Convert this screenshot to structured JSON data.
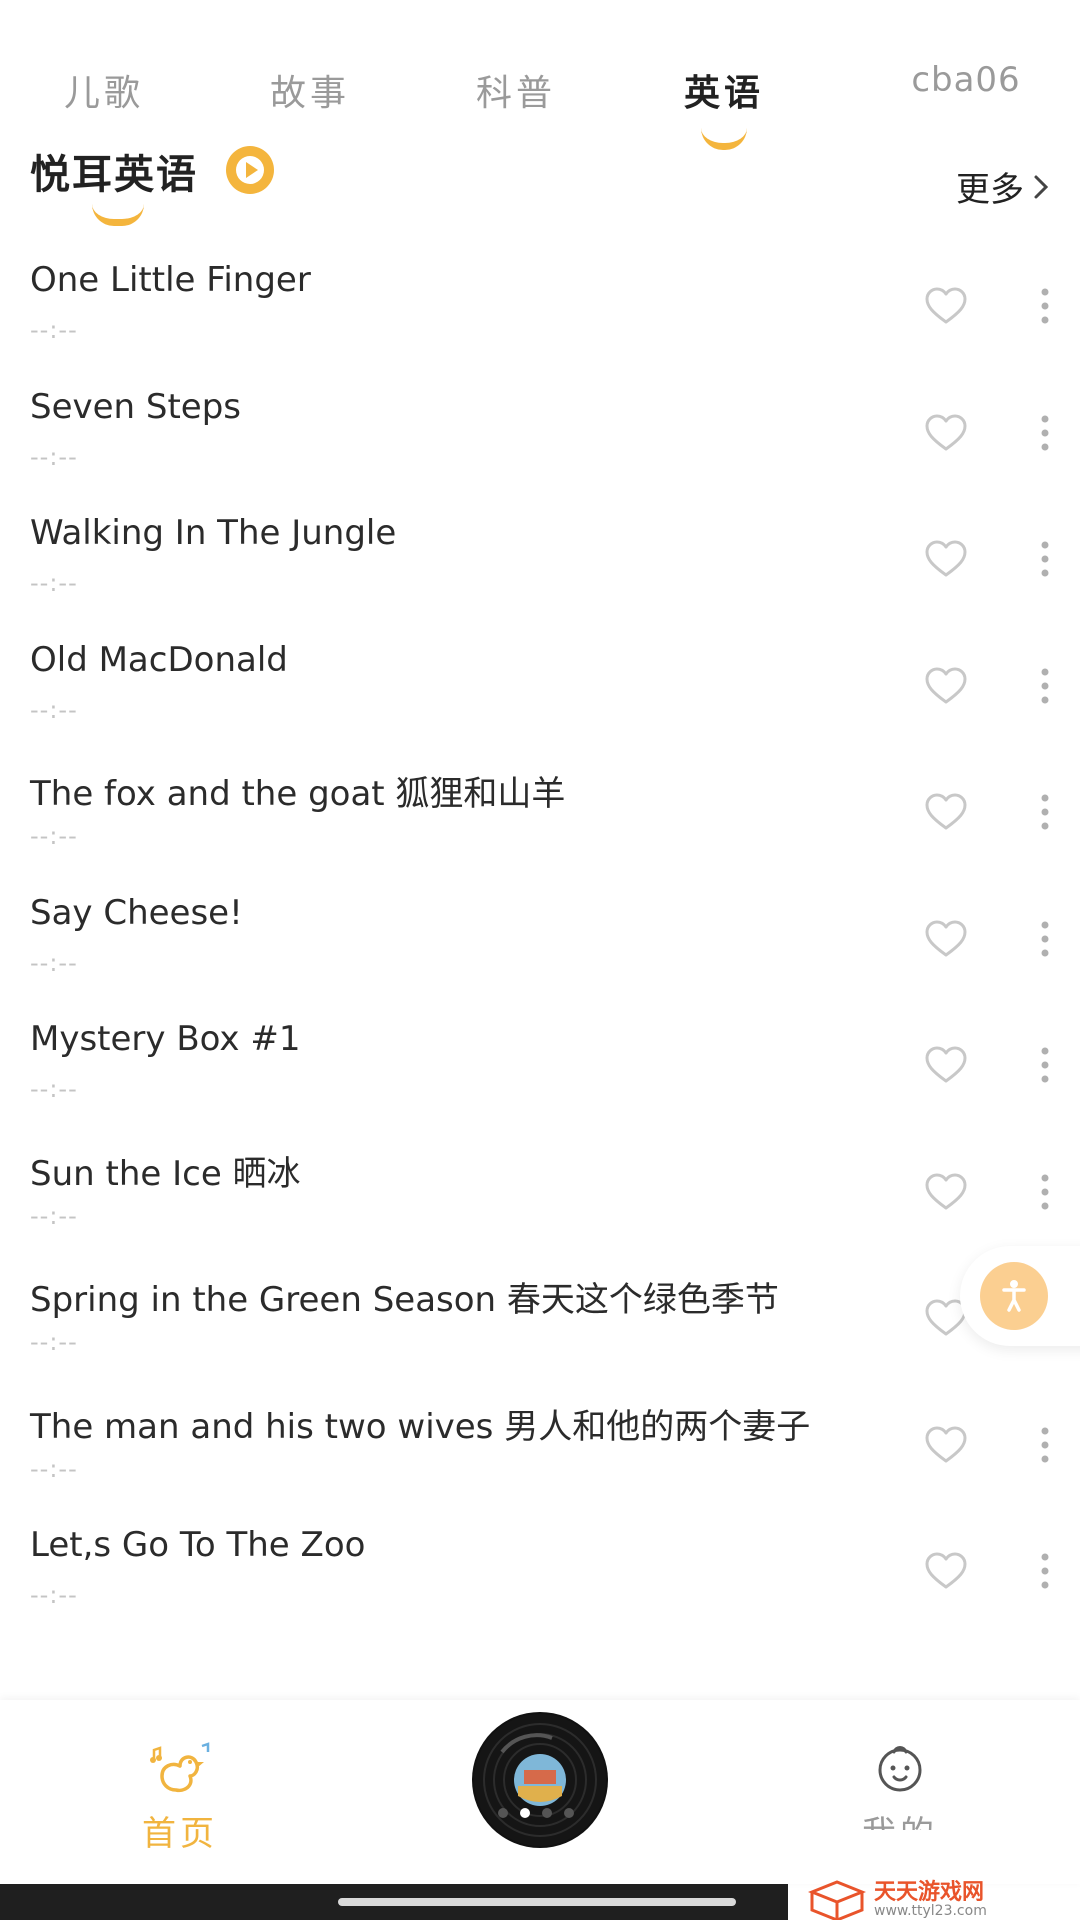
{
  "tabs": [
    {
      "label": "儿歌",
      "active": false
    },
    {
      "label": "故事",
      "active": false
    },
    {
      "label": "科普",
      "active": false
    },
    {
      "label": "英语",
      "active": true
    },
    {
      "label": "cba06",
      "active": false
    }
  ],
  "section": {
    "title": "悦耳英语",
    "more_label": "更多"
  },
  "songs": [
    {
      "title": "One Little Finger",
      "duration": "--:--"
    },
    {
      "title": "Seven Steps",
      "duration": "--:--"
    },
    {
      "title": "Walking In The Jungle",
      "duration": "--:--"
    },
    {
      "title": "Old MacDonald",
      "duration": "--:--"
    },
    {
      "title": "The fox and the goat 狐狸和山羊",
      "duration": "--:--"
    },
    {
      "title": "Say Cheese!",
      "duration": "--:--"
    },
    {
      "title": "Mystery Box #1",
      "duration": "--:--"
    },
    {
      "title": "Sun the Ice 晒冰",
      "duration": "--:--"
    },
    {
      "title": "Spring in the Green Season 春天这个绿色季节",
      "duration": "--:--"
    },
    {
      "title": "The man and his two wives 男人和他的两个妻子",
      "duration": "--:--"
    },
    {
      "title": "Let,s Go To The Zoo",
      "duration": "--:--"
    }
  ],
  "bottom_nav": {
    "home_label": "首页",
    "me_label": "我的"
  },
  "watermark": {
    "name": "天天游戏网",
    "url": "www.ttyl23.com"
  },
  "colors": {
    "accent": "#f4b53d",
    "text": "#2b2b2b",
    "muted": "#9a9a9a",
    "float_button": "#fbcf91"
  }
}
